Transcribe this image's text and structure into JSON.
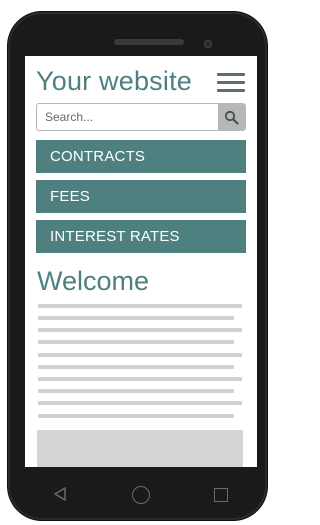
{
  "site": {
    "title": "Your website"
  },
  "search": {
    "placeholder": "Search..."
  },
  "nav": {
    "items": [
      {
        "label": "CONTRACTS"
      },
      {
        "label": "FEES"
      },
      {
        "label": "INTEREST RATES"
      }
    ]
  },
  "content": {
    "heading": "Welcome"
  },
  "icons": {
    "menu": "hamburger-menu-icon",
    "search": "magnifier-icon",
    "back": "triangle-back-icon",
    "home": "circle-home-icon",
    "recent": "square-recent-apps-icon"
  },
  "colors": {
    "accent": "#4f8080",
    "nav_text": "#ffffff",
    "placeholder_bar": "#d2d2d2",
    "search_button": "#b5b8b8",
    "phone_body": "#1a1a1a"
  }
}
